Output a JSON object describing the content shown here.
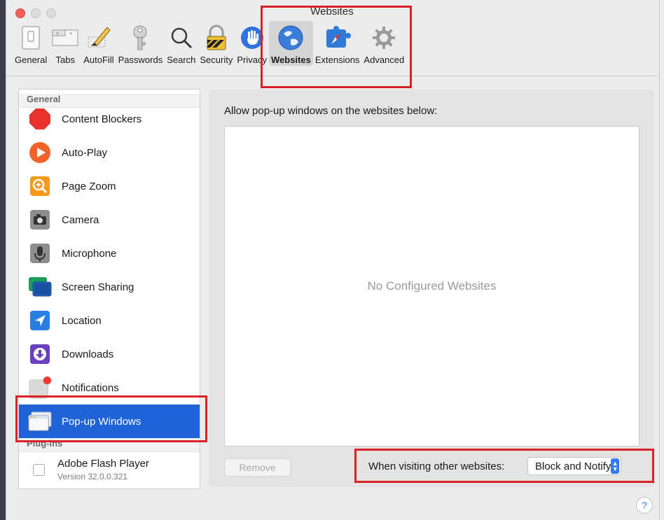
{
  "window": {
    "title": "Websites"
  },
  "toolbar": {
    "items": [
      {
        "label": "General",
        "icon": "general-switch-icon"
      },
      {
        "label": "Tabs",
        "icon": "tabs-icon"
      },
      {
        "label": "AutoFill",
        "icon": "autofill-pencil-icon"
      },
      {
        "label": "Passwords",
        "icon": "key-icon"
      },
      {
        "label": "Search",
        "icon": "magnifier-icon"
      },
      {
        "label": "Security",
        "icon": "padlock-icon"
      },
      {
        "label": "Privacy",
        "icon": "hand-icon"
      },
      {
        "label": "Websites",
        "icon": "globe-icon"
      },
      {
        "label": "Extensions",
        "icon": "puzzle-compass-icon"
      },
      {
        "label": "Advanced",
        "icon": "gear-icon"
      }
    ],
    "selected": "Websites"
  },
  "sidebar": {
    "general_header": "General",
    "items": [
      {
        "label": "Content Blockers",
        "icon": "stop-octagon-icon"
      },
      {
        "label": "Auto-Play",
        "icon": "play-circle-icon"
      },
      {
        "label": "Page Zoom",
        "icon": "zoom-in-icon"
      },
      {
        "label": "Camera",
        "icon": "camera-icon"
      },
      {
        "label": "Microphone",
        "icon": "microphone-icon"
      },
      {
        "label": "Screen Sharing",
        "icon": "screen-sharing-icon"
      },
      {
        "label": "Location",
        "icon": "location-arrow-icon"
      },
      {
        "label": "Downloads",
        "icon": "download-icon"
      },
      {
        "label": "Notifications",
        "icon": "notification-badge-icon"
      },
      {
        "label": "Pop-up Windows",
        "icon": "popup-window-icon"
      }
    ],
    "selected": "Pop-up Windows",
    "plugins_header": "Plug-ins",
    "plugin": {
      "name": "Adobe Flash Player",
      "version": "Version 32.0.0.321"
    }
  },
  "main": {
    "allow_label": "Allow pop-up windows on the websites below:",
    "empty_text": "No Configured Websites",
    "remove_button": "Remove",
    "other_sites_label": "When visiting other websites:",
    "other_sites_value": "Block and Notify"
  },
  "help": "?",
  "colors": {
    "selection": "#1f63d6",
    "highlight_box": "#d8232a",
    "accent": "#2f7cf6"
  }
}
